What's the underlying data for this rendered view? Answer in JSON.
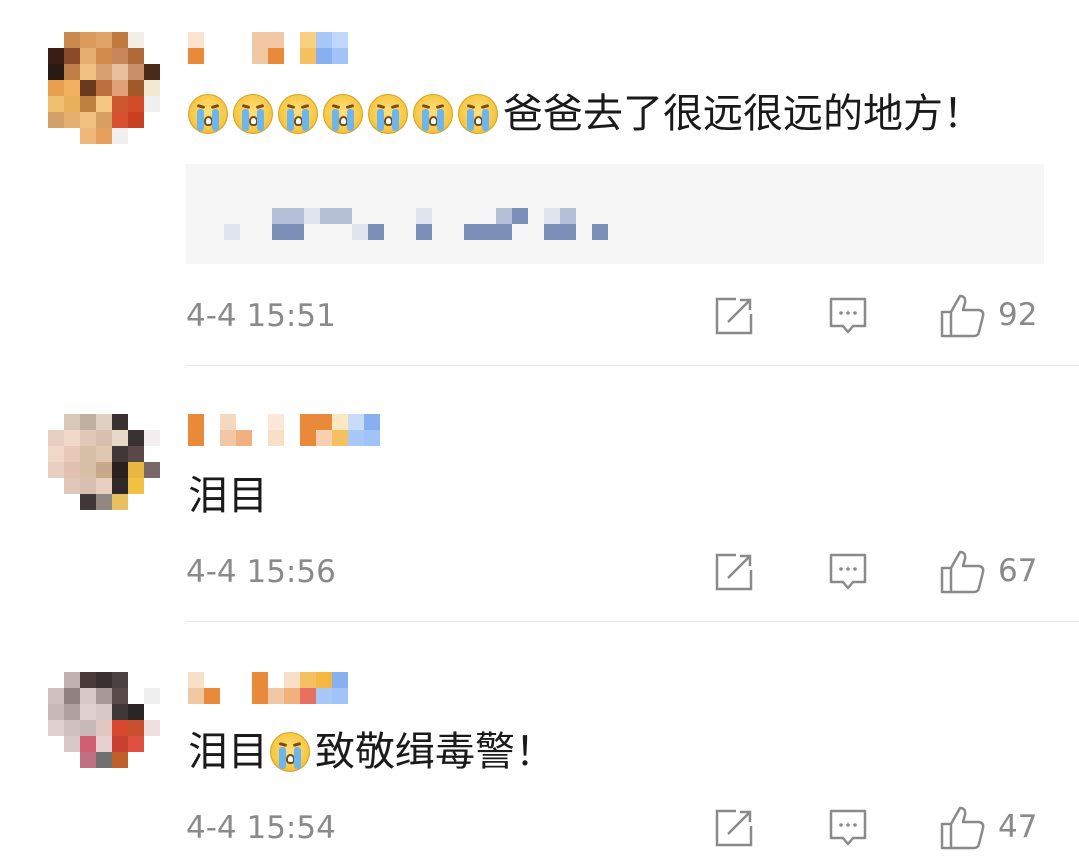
{
  "comments": [
    {
      "text_segments": [
        "爸爸去了很远很远的地方！"
      ],
      "emoji_count": 7,
      "emoji_name": "crying-emoji",
      "time": "4-4 15:51",
      "likes": "92",
      "avatar_colors": [
        "#ffffff",
        "#c88a4e",
        "#d99a5a",
        "#e0a468",
        "#c07a3e",
        "#f2efe9",
        "#ffffff",
        "#3a1d14",
        "#8a4a2a",
        "#e8b070",
        "#d48a4a",
        "#c8865a",
        "#b06a3a",
        "#ffffff",
        "#2a1a14",
        "#c0804a",
        "#f0c080",
        "#d4a070",
        "#e8c0a0",
        "#c89068",
        "#4a2a1a",
        "#e8a050",
        "#f2b060",
        "#6a3a1e",
        "#c07040",
        "#e0a078",
        "#a05a2a",
        "#f0e8d0",
        "#f0c070",
        "#e8b058",
        "#c08040",
        "#f4c880",
        "#d0582e",
        "#d24a26",
        "#f0f0f0",
        "#d4a068",
        "#e8b070",
        "#f0c080",
        "#d8a060",
        "#d85030",
        "#c84020",
        "#ffffff",
        "#ffffff",
        "#ffffff",
        "#f0b878",
        "#e8a060",
        "#f2f0ee",
        "#ffffff",
        "#ffffff"
      ],
      "name_colors": [
        "#fbe3cf",
        "#e88a3a",
        "#ffffff",
        "#ffffff",
        "#ffffff",
        "#ffffff",
        "#ffffff",
        "#ffffff",
        "#f2c8a4",
        "#f2c8a4",
        "#f2c8a4",
        "#e88a3a",
        "#ffffff",
        "#ffffff",
        "#f9d080",
        "#f5c060",
        "#a8c8f8",
        "#88b0f0",
        "#c0d8fc",
        "#a0c4f8"
      ]
    },
    {
      "text_segments": [
        "泪目"
      ],
      "emoji_count": 0,
      "time": "4-4 15:56",
      "likes": "67",
      "avatar_colors": [
        "#ffffff",
        "#d8c8b8",
        "#c0b0a0",
        "#e0d0c0",
        "#3a3030",
        "#ffffff",
        "#ffffff",
        "#e8d0c0",
        "#f0d8c8",
        "#e0c8b8",
        "#d8c0b0",
        "#e8d8c8",
        "#3a3232",
        "#f4eef0",
        "#f0d8c8",
        "#e8c8b8",
        "#d8c0a8",
        "#e0c8b0",
        "#403838",
        "#5a4848",
        "#ffffff",
        "#e8d0c0",
        "#e0c0b0",
        "#d8c0a8",
        "#c8a888",
        "#2a2020",
        "#e8b840",
        "#7a6868",
        "#ffffff",
        "#e0c8b8",
        "#d8c0b0",
        "#e8d0c0",
        "#302828",
        "#f0c040",
        "#ffffff",
        "#ffffff",
        "#ffffff",
        "#403838",
        "#908880",
        "#e8c060",
        "#ffffff",
        "#ffffff",
        "#ffffff",
        "#ffffff",
        "#ffffff",
        "#ffffff",
        "#ffffff",
        "#ffffff",
        "#ffffff"
      ],
      "name_colors": [
        "#e88a3a",
        "#e88a3a",
        "#ffffff",
        "#ffffff",
        "#f4d8c0",
        "#f2c8a4",
        "#ffffff",
        "#f0b080",
        "#ffffff",
        "#ffffff",
        "#fbe8d8",
        "#f8e0c8",
        "#ffffff",
        "#ffffff",
        "#e88a3a",
        "#e88a3a",
        "#e88a3a",
        "#f8d0b0",
        "#fbe8c0",
        "#f5c060",
        "#c8dcfa",
        "#a8c8f8",
        "#88b0f0",
        "#a0c4f8"
      ]
    },
    {
      "text_segments": [
        "泪目",
        "致敬缉毒警！"
      ],
      "emoji_count": 1,
      "emoji_name": "crying-emoji",
      "time": "4-4 15:54",
      "likes": "47",
      "avatar_colors": [
        "#ffffff",
        "#c0b0b0",
        "#4a3a3a",
        "#3a3030",
        "#4a4040",
        "#ffffff",
        "#ffffff",
        "#d0c0c0",
        "#908080",
        "#d8c8c8",
        "#a89898",
        "#5a4a48",
        "#ffffff",
        "#f0f0f0",
        "#c8b8b8",
        "#b0a0a0",
        "#e0d0d0",
        "#d8c8c8",
        "#403838",
        "#2a2424",
        "#ffffff",
        "#e0d0d0",
        "#d0c0c0",
        "#c8b8b8",
        "#e0c8c0",
        "#d84830",
        "#c85030",
        "#f0e0e0",
        "#ffffff",
        "#d8c8c8",
        "#d06070",
        "#e8d0d0",
        "#c84030",
        "#e05040",
        "#ffffff",
        "#ffffff",
        "#ffffff",
        "#c07080",
        "#707070",
        "#c0602a",
        "#ffffff",
        "#ffffff",
        "#ffffff",
        "#ffffff",
        "#ffffff",
        "#ffffff",
        "#ffffff",
        "#ffffff",
        "#ffffff"
      ],
      "name_colors": [
        "#f8e0c8",
        "#f2c8a4",
        "#ffffff",
        "#e88a3a",
        "#ffffff",
        "#ffffff",
        "#ffffff",
        "#ffffff",
        "#e88a3a",
        "#e88a3a",
        "#ffffff",
        "#f2c8a4",
        "#f8e0c8",
        "#f2b07a",
        "#f5c060",
        "#e87060",
        "#f4b840",
        "#a8c8f8",
        "#88b0f0",
        "#a0c4f8"
      ]
    }
  ],
  "quote_mosaic_colors": {
    "light": "#dfe4ee",
    "mid": "#b4c0d8",
    "dark": "#7a90b8"
  },
  "icons": {
    "share": "share-icon",
    "comment": "comment-icon",
    "like": "thumbs-up-icon"
  }
}
